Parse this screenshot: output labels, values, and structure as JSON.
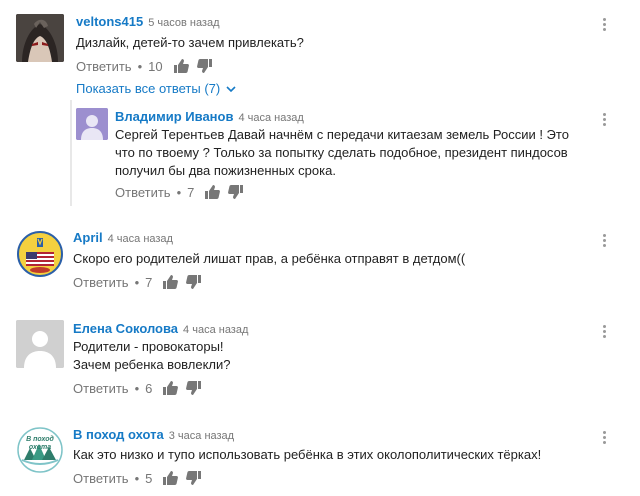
{
  "comments": [
    {
      "author": "veltons415",
      "time": "5 часов назад",
      "text": "Дизлайк, детей-то зачем привлекать?",
      "reply_label": "Ответить",
      "likes": "10",
      "show_replies": "Показать все ответы (7)"
    },
    {
      "author": "April",
      "time": "4 часа назад",
      "text": "Скоро его родителей лишат прав, а ребёнка отправят в детдом((",
      "reply_label": "Ответить",
      "likes": "7"
    },
    {
      "author": "Елена Соколова",
      "time": "4 часа назад",
      "text": "Родители  - провокаторы!\nЗачем ребенка вовлекли?",
      "reply_label": "Ответить",
      "likes": "6"
    },
    {
      "author": "В поход охота",
      "time": "3 часа назад",
      "text": "Как это низко и тупо использовать ребёнка в этих околополитических тёрках!",
      "reply_label": "Ответить",
      "likes": "5",
      "avatar_text": "В поход охота"
    }
  ],
  "reply": {
    "author": "Владимир Иванов",
    "time": "4 часа назад",
    "text": "Сергей Терентьев  Давай начнём с передачи китаезам земель России !  Это\nчто по твоему ?  Только за попытку сделать подобное,  президент пиндосов\nполучил бы два пожизненных срока.",
    "reply_label": "Ответить",
    "likes": "7"
  },
  "colors": {
    "link": "#167ac6",
    "muted": "#767676",
    "reply_avatar": "#9c8fcf",
    "default_avatar": "#d0d0d0"
  },
  "icons": [
    "thumb-up-icon",
    "thumb-down-icon",
    "more-vert-icon",
    "chevron-down-icon"
  ]
}
